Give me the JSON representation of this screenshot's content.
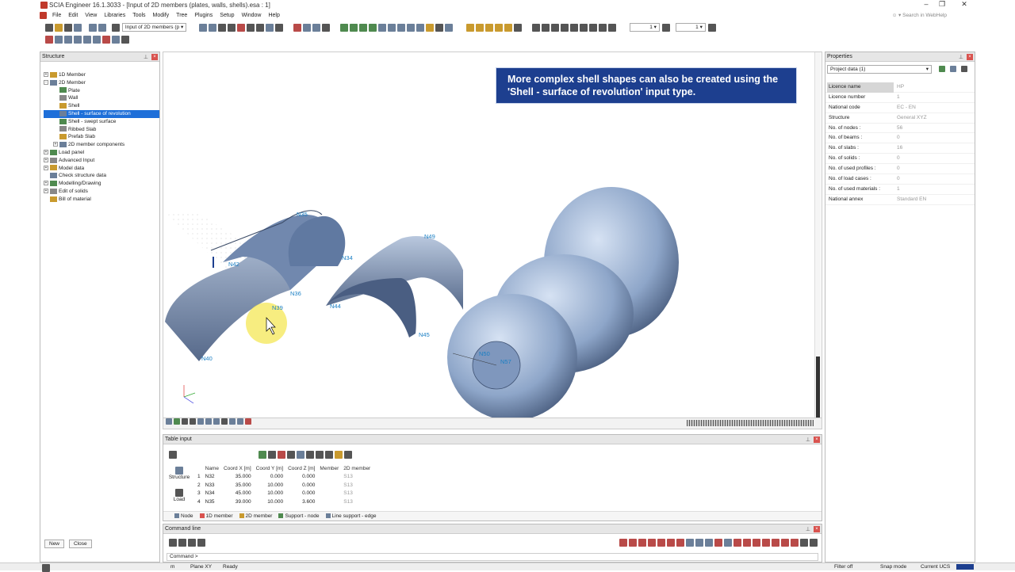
{
  "window": {
    "title": "SCIA Engineer 16.1.3033 - [Input of 2D members (plates, walls, shells).esa : 1]"
  },
  "menu": [
    "File",
    "Edit",
    "View",
    "Libraries",
    "Tools",
    "Modify",
    "Tree",
    "Plugins",
    "Setup",
    "Window",
    "Help"
  ],
  "search": {
    "placeholder": "Search in WebHelp"
  },
  "toolbar": {
    "combo": "Input of 2D members (p",
    "zoom_a": "1",
    "zoom_b": "1"
  },
  "structure": {
    "title": "Structure",
    "items": [
      {
        "label": "1D Member",
        "level": 0,
        "exp": "+"
      },
      {
        "label": "2D Member",
        "level": 0,
        "exp": "-"
      },
      {
        "label": "Plate",
        "level": 1
      },
      {
        "label": "Wall",
        "level": 1
      },
      {
        "label": "Shell",
        "level": 1
      },
      {
        "label": "Shell - surface of revolution",
        "level": 1,
        "selected": true
      },
      {
        "label": "Shell - swept surface",
        "level": 1
      },
      {
        "label": "Ribbed Slab",
        "level": 1
      },
      {
        "label": "Prefab Slab",
        "level": 1
      },
      {
        "label": "2D member components",
        "level": 1,
        "exp": "+"
      },
      {
        "label": "Load panel",
        "level": 0,
        "exp": "+"
      },
      {
        "label": "Advanced Input",
        "level": 0,
        "exp": "+"
      },
      {
        "label": "Model data",
        "level": 0,
        "exp": "+"
      },
      {
        "label": "Check structure data",
        "level": 0
      },
      {
        "label": "Modelling/Drawing",
        "level": 0,
        "exp": "+"
      },
      {
        "label": "Edit of solids",
        "level": 0,
        "exp": "+"
      },
      {
        "label": "Bill of material",
        "level": 0
      }
    ],
    "new_label": "New",
    "close_label": "Close"
  },
  "viewport": {
    "hint": "More complex shell shapes can also be created using the 'Shell - surface of revolution' input type.",
    "nodes": [
      {
        "label": "N35",
        "cls": "n35"
      },
      {
        "label": "N34",
        "cls": "n34"
      },
      {
        "label": "N42",
        "cls": "n42"
      },
      {
        "label": "N36",
        "cls": "n36"
      },
      {
        "label": "N39",
        "cls": "n39"
      },
      {
        "label": "N40",
        "cls": "n40"
      },
      {
        "label": "N49",
        "cls": "n49"
      },
      {
        "label": "N44",
        "cls": "n44"
      },
      {
        "label": "N45",
        "cls": "n45"
      },
      {
        "label": "N50",
        "cls": "n50"
      },
      {
        "label": "N57",
        "cls": "n57"
      }
    ]
  },
  "properties": {
    "title": "Properties",
    "selector": "Project data (1)",
    "rows": [
      {
        "k": "Licence name",
        "v": "HP"
      },
      {
        "k": "Licence number",
        "v": "1"
      },
      {
        "k": "National code",
        "v": "EC - EN"
      },
      {
        "k": "Structure",
        "v": "General XYZ"
      },
      {
        "k": "No. of nodes :",
        "v": "56"
      },
      {
        "k": "No. of beams :",
        "v": "0"
      },
      {
        "k": "No. of slabs :",
        "v": "16"
      },
      {
        "k": "No. of solids :",
        "v": "0"
      },
      {
        "k": "No. of used profiles :",
        "v": "0"
      },
      {
        "k": "No. of load cases :",
        "v": "0"
      },
      {
        "k": "No. of used materials :",
        "v": "1"
      },
      {
        "k": "National annex",
        "v": "Standard EN"
      }
    ]
  },
  "table_input": {
    "title": "Table input",
    "side": [
      "Structure",
      "Load"
    ],
    "columns": [
      "",
      "Name",
      "Coord X [m]",
      "Coord Y [m]",
      "Coord Z [m]",
      "Member",
      "2D member"
    ],
    "rows": [
      [
        "1",
        "N32",
        "35.000",
        "0.000",
        "0.000",
        "",
        "S13"
      ],
      [
        "2",
        "N33",
        "35.000",
        "10.000",
        "0.000",
        "",
        "S13"
      ],
      [
        "3",
        "N34",
        "45.000",
        "10.000",
        "0.000",
        "",
        "S13"
      ],
      [
        "4",
        "N35",
        "39.000",
        "10.000",
        "3.600",
        "",
        "S13"
      ]
    ],
    "tabs": [
      "Node",
      "1D member",
      "2D member",
      "Support - node",
      "Line support - edge"
    ]
  },
  "command_line": {
    "title": "Command line",
    "prompt": "Command >"
  },
  "status": {
    "left": "m",
    "plane": "Plane XY",
    "ready": "Ready",
    "filter": "Filter off",
    "snap": "Snap mode",
    "ucs": "Current UCS"
  },
  "colors": {
    "selection": "#1e6fd9",
    "hint_bg": "#1d3f8f",
    "node_label": "#1a7fc4",
    "shell": "#8ea6c9"
  }
}
